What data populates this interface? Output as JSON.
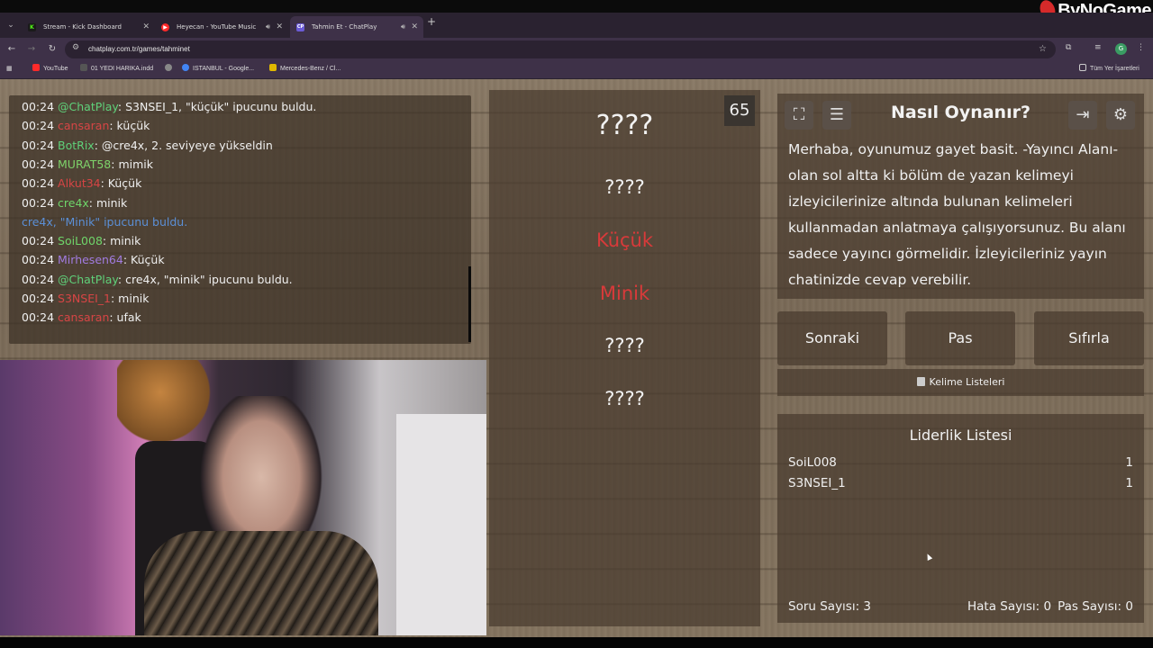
{
  "watermark": "ByNoGame",
  "browser": {
    "tabs": [
      {
        "label": "Stream - Kick Dashboard",
        "favicon": "K",
        "color": "#53fc18"
      },
      {
        "label": "Heyecan - YouTube Music",
        "favicon": "▶",
        "color": "#ff2a2a"
      },
      {
        "label": "Tahmin Et - ChatPlay",
        "favicon": "CP",
        "color": "#6b5bd6"
      }
    ],
    "new_tab": "+",
    "url": "chatplay.com.tr/games/tahminet",
    "bookmarks": [
      {
        "label": "YouTube",
        "color": "#ff2a2a"
      },
      {
        "label": "01 YEDI HARIKA.indd",
        "color": "#555"
      },
      {
        "label": "",
        "color": "#888"
      },
      {
        "label": "ISTANBUL - Google...",
        "color": "#4285f4"
      },
      {
        "label": "Mercedes-Benz / Cl...",
        "color": "#e0b800"
      }
    ],
    "bookmarks_right": "Tüm Yer İşaretleri",
    "profile_initial": "G"
  },
  "chat": {
    "lines": [
      {
        "time": "00:24",
        "user": "@ChatPlay",
        "user_color": "#5fd17a",
        "text": ": S3NSEI_1, \"küçük\" ipucunu buldu."
      },
      {
        "time": "00:24",
        "user": "cansaran",
        "user_color": "#d74545",
        "text": ": küçük"
      },
      {
        "time": "00:24",
        "user": "BotRix",
        "user_color": "#5fd17a",
        "text": ": @cre4x, 2. seviyeye yükseldin"
      },
      {
        "time": "00:24",
        "user": "MURAT58",
        "user_color": "#7ed36a",
        "text": ": mimik"
      },
      {
        "time": "00:24",
        "user": "Alkut34",
        "user_color": "#d74545",
        "text": ": Küçük"
      },
      {
        "time": "00:24",
        "user": "cre4x",
        "user_color": "#6fd56a",
        "text": ": minik"
      },
      {
        "time": "",
        "user": "cre4x, \"Minik\" ipucunu buldu.",
        "user_color": "#5b8fd6",
        "text": ""
      },
      {
        "time": "00:24",
        "user": "SoiL008",
        "user_color": "#6fd56a",
        "text": ": minik"
      },
      {
        "time": "00:24",
        "user": "Mirhesen64",
        "user_color": "#a17be0",
        "text": ": Küçük"
      },
      {
        "time": "00:24",
        "user": "@ChatPlay",
        "user_color": "#5fd17a",
        "text": ": cre4x, \"minik\" ipucunu buldu."
      },
      {
        "time": "00:24",
        "user": "S3NSEI_1",
        "user_color": "#d74545",
        "text": ": minik"
      },
      {
        "time": "00:24",
        "user": "cansaran",
        "user_color": "#d74545",
        "text": ": ufak"
      }
    ]
  },
  "game": {
    "timer": "65",
    "words": [
      {
        "text": "????",
        "found": false,
        "size": "big"
      },
      {
        "text": "????",
        "found": false,
        "size": "normal"
      },
      {
        "text": "Küçük",
        "found": true,
        "size": "normal"
      },
      {
        "text": "Minik",
        "found": true,
        "size": "normal"
      },
      {
        "text": "????",
        "found": false,
        "size": "normal"
      },
      {
        "text": "????",
        "found": false,
        "size": "normal"
      }
    ]
  },
  "help": {
    "title": "Nasıl Oynanır?",
    "body": "Merhaba, oyunumuz gayet basit. -Yayıncı Alanı- olan sol altta ki bölüm de yazan kelimeyi izleyicilerinize altında bulunan kelimeleri kullanmadan anlatmaya çalışıyorsunuz. Bu alanı sadece yayıncı görmelidir. İzleyicileriniz yayın chatinizde cevap verebilir."
  },
  "buttons": {
    "next": "Sonraki",
    "pass": "Pas",
    "reset": "Sıfırla",
    "word_lists": "Kelime Listeleri"
  },
  "leaderboard": {
    "title": "Liderlik Listesi",
    "rows": [
      {
        "name": "SoiL008",
        "score": "1"
      },
      {
        "name": "S3NSEI_1",
        "score": "1"
      }
    ],
    "question_count": "Soru Sayısı: 3",
    "error_count": "Hata Sayısı: 0",
    "pass_count": "Pas Sayısı: 0"
  }
}
